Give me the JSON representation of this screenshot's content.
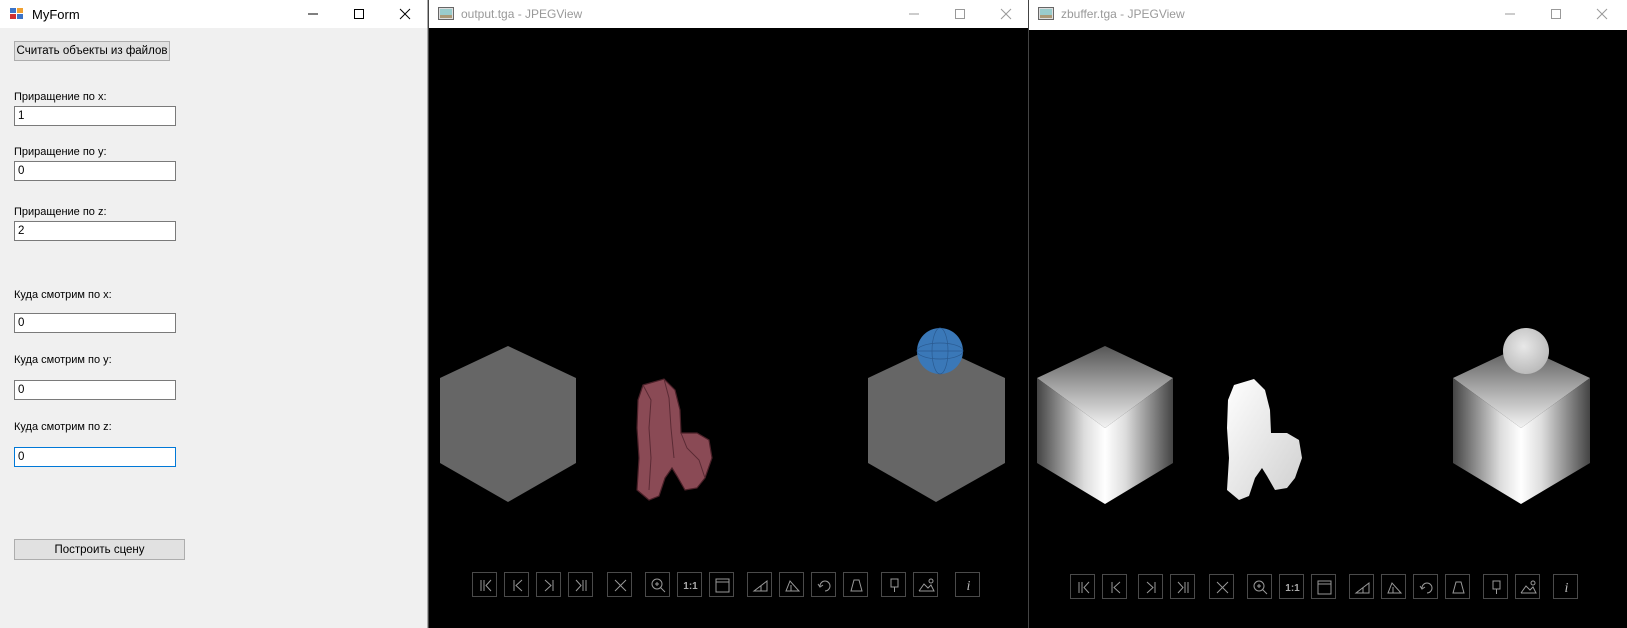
{
  "myform": {
    "title": "MyForm",
    "load_button": "Считать объекты из файлов",
    "fields": [
      {
        "label": "Приращение по x:",
        "value": "1"
      },
      {
        "label": "Приращение по y:",
        "value": "0"
      },
      {
        "label": "Приращение по z:",
        "value": "2"
      },
      {
        "label": "Куда смотрим по x:",
        "value": "0"
      },
      {
        "label": "Куда смотрим по y:",
        "value": "0"
      },
      {
        "label": "Куда смотрим по z:",
        "value": "0"
      }
    ],
    "build_button": "Построить сцену"
  },
  "output_viewer": {
    "title": "output.tga - JPEGView"
  },
  "zbuffer_viewer": {
    "title": "zbuffer.tga - JPEGView"
  },
  "toolbar_icons": [
    "first-image-icon",
    "prev-image-icon",
    "next-image-icon",
    "last-image-icon",
    "delete-icon",
    "zoom-icon",
    "actual-size-icon",
    "fit-window-icon",
    "rotate-left-icon",
    "rotate-right-icon",
    "rotate-icon",
    "perspective-icon",
    "keep-params-icon",
    "landscape-icon",
    "info-icon"
  ],
  "toolbar_text": {
    "actual_size": "1:1",
    "info": "i"
  },
  "colors": {
    "form_bg": "#f0f0f0",
    "focus_border": "#0078d7",
    "cube_gray": "#666666",
    "chair_red": "#8a4a55",
    "sphere_blue": "#3a78b8"
  }
}
